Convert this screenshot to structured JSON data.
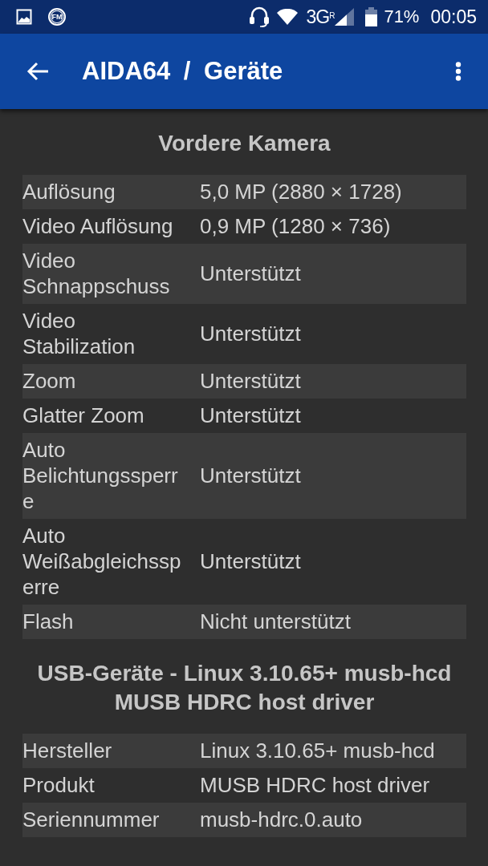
{
  "status_bar": {
    "fm_label": "FM",
    "network": "3G",
    "roaming": "R",
    "battery": "71%",
    "time": "00:05"
  },
  "app_bar": {
    "title": "AIDA64 / Geräte"
  },
  "sections": [
    {
      "title": "Vordere Kamera",
      "rows": [
        {
          "label": "Auflösung",
          "value": "5,0 MP (2880 × 1728)"
        },
        {
          "label": "Video Auflösung",
          "value": "0,9 MP (1280 × 736)"
        },
        {
          "label": "Video Schnappschuss",
          "value": "Unterstützt"
        },
        {
          "label": "Video Stabilization",
          "value": "Unterstützt"
        },
        {
          "label": "Zoom",
          "value": "Unterstützt"
        },
        {
          "label": "Glatter Zoom",
          "value": "Unterstützt"
        },
        {
          "label": "Auto Belichtungssperre",
          "value": "Unterstützt"
        },
        {
          "label": "Auto Weißabgleichssperre",
          "value": "Unterstützt"
        },
        {
          "label": "Flash",
          "value": "Nicht unterstützt"
        }
      ]
    },
    {
      "title": "USB-Geräte - Linux 3.10.65+ musb-hcd MUSB HDRC host driver",
      "rows": [
        {
          "label": "Hersteller",
          "value": "Linux 3.10.65+ musb-hcd"
        },
        {
          "label": "Produkt",
          "value": "MUSB HDRC host driver"
        },
        {
          "label": "Seriennummer",
          "value": "musb-hdrc.0.auto"
        }
      ]
    }
  ]
}
